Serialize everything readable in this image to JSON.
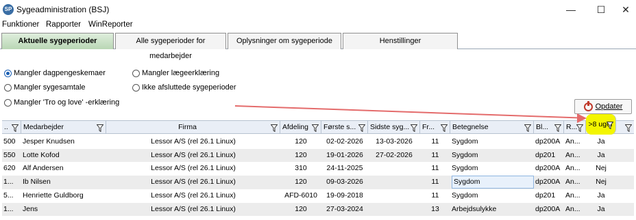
{
  "window": {
    "app_icon_text": "SP",
    "title": "Sygeadministration  (BSJ)",
    "minimize": "—",
    "maximize": "☐",
    "close": "✕"
  },
  "menu": [
    "Funktioner",
    "Rapporter",
    "WinReporter"
  ],
  "tabs": [
    {
      "label": "Aktuelle sygeperioder",
      "active": true
    },
    {
      "label": "Alle sygeperioder for medarbejder",
      "active": false
    },
    {
      "label": "Oplysninger  om sygeperiode",
      "active": false
    },
    {
      "label": "Henstillinger",
      "active": false
    }
  ],
  "filters": [
    {
      "label": "Mangler dagpengeskemaer",
      "checked": true
    },
    {
      "label": "Mangler sygesamtale",
      "checked": false
    },
    {
      "label": "Mangler 'Tro og love' -erklæring",
      "checked": false
    },
    {
      "label": "Mangler lægeerklæring",
      "checked": false
    },
    {
      "label": "Ikke afsluttede sygeperioder",
      "checked": false
    }
  ],
  "refresh_button": "Opdater",
  "columns": [
    "..",
    "Medarbejder",
    "Firma",
    "Afdeling",
    "Første s...",
    "Sidste syg...",
    "Fr...",
    "Betegnelse",
    "Bl...",
    "R...",
    ">8 uger"
  ],
  "rows": [
    [
      "500",
      "Jesper Knudsen",
      "Lessor A/S (rel 26.1 Linux)",
      "120",
      "02-02-2026",
      "13-03-2026",
      "11",
      "Sygdom",
      "dp200A",
      "An...",
      "Ja"
    ],
    [
      "550",
      "Lotte Kofod",
      "Lessor A/S (rel 26.1 Linux)",
      "120",
      "19-01-2026",
      "27-02-2026",
      "11",
      "Sygdom",
      "dp201",
      "An...",
      "Ja"
    ],
    [
      "620",
      "Alf Andersen",
      "Lessor A/S (rel 26.1 Linux)",
      "310",
      "24-11-2025",
      "",
      "11",
      "Sygdom",
      "dp200A",
      "An...",
      "Nej"
    ],
    [
      "1...",
      "Ib Nilsen",
      "Lessor A/S (rel 26.1 Linux)",
      "120",
      "09-03-2026",
      "",
      "11",
      "Sygdom",
      "dp200A",
      "An...",
      "Nej"
    ],
    [
      "5...",
      "Henriette Guldborg",
      "Lessor A/S (rel 26.1 Linux)",
      "AFD-6010",
      "19-09-2018",
      "",
      "11",
      "Sygdom",
      "dp201",
      "An...",
      "Ja"
    ],
    [
      "1...",
      "Jens",
      "Lessor A/S (rel 26.1 Linux)",
      "120",
      "27-03-2024",
      "",
      "13",
      "Arbejdsulykke",
      "dp200A",
      "An...",
      "Ja"
    ]
  ],
  "selected_row_index": 3,
  "colors": {
    "highlight": "#f3f500",
    "arrow": "#e46b6b",
    "active_tab": "#b9d7b4"
  }
}
